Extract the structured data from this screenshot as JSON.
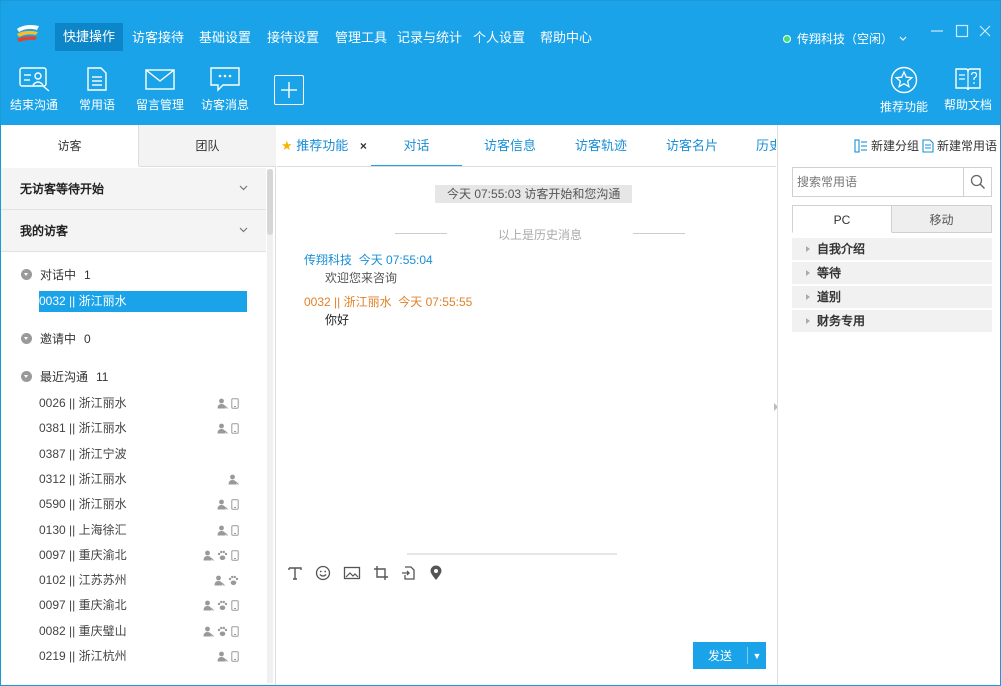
{
  "menubar": {
    "items": [
      "快捷操作",
      "访客接待",
      "基础设置",
      "接待设置",
      "管理工具",
      "记录与统计",
      "个人设置",
      "帮助中心"
    ],
    "active_index": 0,
    "status_text": "传翔科技（空闲）",
    "status_color": "#40e070"
  },
  "toolbar": {
    "left_tools": [
      {
        "label": "结束沟通",
        "icon": "end-chat-icon"
      },
      {
        "label": "常用语",
        "icon": "phrases-icon"
      },
      {
        "label": "留言管理",
        "icon": "mail-icon"
      },
      {
        "label": "访客消息",
        "icon": "visitor-message-icon"
      }
    ],
    "right_tools": [
      {
        "label": "推荐功能",
        "icon": "star-icon"
      },
      {
        "label": "帮助文档",
        "icon": "help-doc-icon"
      }
    ]
  },
  "left": {
    "tabs": [
      "访客",
      "团队"
    ],
    "sections": [
      "无访客等待开始",
      "我的访客"
    ],
    "groups": [
      {
        "label": "对话中",
        "count": "1"
      },
      {
        "label": "邀请中",
        "count": "0"
      },
      {
        "label": "最近沟通",
        "count": "11"
      }
    ],
    "active_visitor": "0032 || 浙江丽水",
    "recent": [
      {
        "text": "0026 || 浙江丽水",
        "icons": [
          "user",
          "mobile"
        ]
      },
      {
        "text": "0381 || 浙江丽水",
        "icons": [
          "user",
          "mobile"
        ]
      },
      {
        "text": "0387 || 浙江宁波",
        "icons": []
      },
      {
        "text": "0312 || 浙江丽水",
        "icons": [
          "user"
        ]
      },
      {
        "text": "0590 || 浙江丽水",
        "icons": [
          "user",
          "mobile"
        ]
      },
      {
        "text": "0130 || 上海徐汇",
        "icons": [
          "user",
          "mobile"
        ]
      },
      {
        "text": "0097 || 重庆渝北",
        "icons": [
          "user",
          "paw",
          "mobile"
        ]
      },
      {
        "text": "0102 || 江苏苏州",
        "icons": [
          "user",
          "paw"
        ]
      },
      {
        "text": "0097 || 重庆渝北",
        "icons": [
          "user",
          "paw",
          "mobile"
        ]
      },
      {
        "text": "0082 || 重庆璧山",
        "icons": [
          "user",
          "paw",
          "mobile"
        ]
      },
      {
        "text": "0219 || 浙江杭州",
        "icons": [
          "user",
          "mobile"
        ]
      }
    ]
  },
  "center": {
    "tabs": [
      "推荐功能",
      "对话",
      "访客信息",
      "访客轨迹",
      "访客名片",
      "历史"
    ],
    "close_label": "×",
    "system_message": "今天 07:55:03 访客开始和您沟通",
    "history_divider": "以上是历史消息",
    "messages": [
      {
        "sender": "传翔科技",
        "time": "今天 07:55:04",
        "text": "欢迎您来咨询",
        "color": "#1a8fd6"
      },
      {
        "sender": "0032 || 浙江丽水",
        "time": "今天 07:55:55",
        "text": "你好",
        "color": "#e0822a"
      }
    ],
    "send_label": "发送"
  },
  "right": {
    "new_group": "新建分组",
    "new_phrase": "新建常用语",
    "search_placeholder": "搜索常用语",
    "tabs": [
      "PC",
      "移动"
    ],
    "categories": [
      "自我介绍",
      "等待",
      "道别",
      "财务专用"
    ]
  },
  "colors": {
    "brand": "#1aa3e8",
    "active_menu": "#0c86c8"
  }
}
